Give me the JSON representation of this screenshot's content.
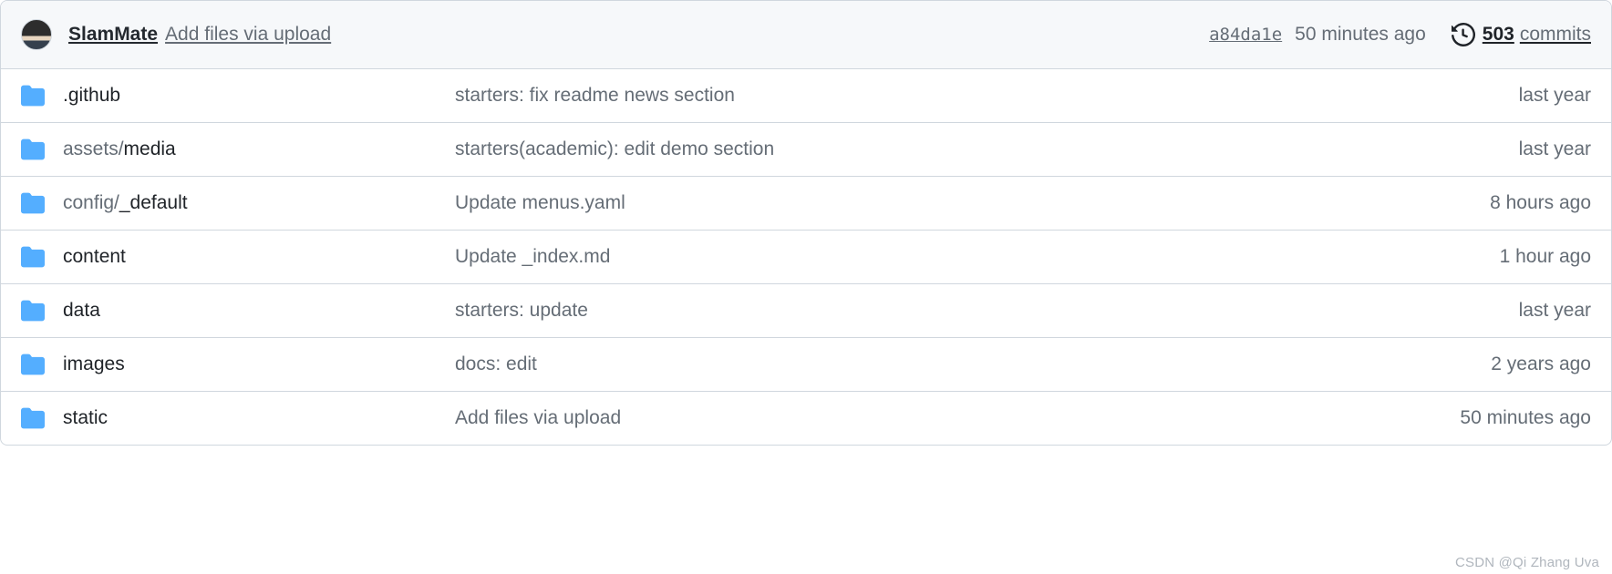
{
  "latest_commit": {
    "author": "SlamMate",
    "message": "Add files via upload",
    "sha": "a84da1e",
    "relative_time": "50 minutes ago"
  },
  "history": {
    "count": "503",
    "label": "commits"
  },
  "files": [
    {
      "path_prefix": "",
      "name": ".github",
      "commit_message": "starters: fix readme news section",
      "age": "last year"
    },
    {
      "path_prefix": "assets/",
      "name": "media",
      "commit_message": "starters(academic): edit demo section",
      "age": "last year"
    },
    {
      "path_prefix": "config/",
      "name": "_default",
      "commit_message": "Update menus.yaml",
      "age": "8 hours ago"
    },
    {
      "path_prefix": "",
      "name": "content",
      "commit_message": "Update _index.md",
      "age": "1 hour ago"
    },
    {
      "path_prefix": "",
      "name": "data",
      "commit_message": "starters: update",
      "age": "last year"
    },
    {
      "path_prefix": "",
      "name": "images",
      "commit_message": "docs: edit",
      "age": "2 years ago"
    },
    {
      "path_prefix": "",
      "name": "static",
      "commit_message": "Add files via upload",
      "age": "50 minutes ago"
    }
  ],
  "watermark": "CSDN @Qi Zhang Uva"
}
